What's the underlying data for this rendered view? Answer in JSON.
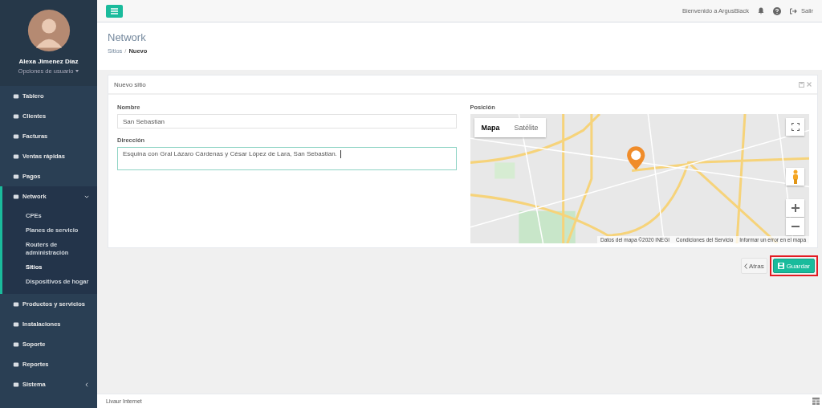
{
  "user": {
    "name": "Alexa Jimenez Díaz",
    "options": "Opciones de usuario"
  },
  "sidebar": {
    "items": [
      {
        "label": "Tablero",
        "selected": false
      },
      {
        "label": "Clientes",
        "selected": false
      },
      {
        "label": "Facturas",
        "selected": false
      },
      {
        "label": "Ventas rápidas",
        "selected": false
      },
      {
        "label": "Pagos",
        "selected": false
      },
      {
        "label": "Network",
        "selected": true,
        "expanded": true,
        "children": [
          {
            "label": "CPEs",
            "selected": false
          },
          {
            "label": "Planes de servicio",
            "selected": false
          },
          {
            "label": "Routers de administración",
            "selected": false
          },
          {
            "label": "Sitios",
            "selected": true
          },
          {
            "label": "Dispositivos de hogar",
            "selected": false
          }
        ]
      },
      {
        "label": "Productos y servicios",
        "selected": false
      },
      {
        "label": "Instalaciones",
        "selected": false
      },
      {
        "label": "Soporte",
        "selected": false
      },
      {
        "label": "Reportes",
        "selected": false
      },
      {
        "label": "Sistema",
        "selected": false,
        "expanded": false
      }
    ]
  },
  "topbar": {
    "welcome": "Bienvenido a ArgusBlack",
    "logout": "Salir"
  },
  "page": {
    "title": "Network",
    "breadcrumb": [
      {
        "label": "Sitios"
      },
      {
        "label": "Nuevo"
      }
    ],
    "separator": "/"
  },
  "panel": {
    "title": "Nuevo sitio",
    "fields": [
      {
        "label": "Nombre",
        "value": "San Sebastian",
        "kind": "input",
        "focused": false
      },
      {
        "label": "Dirección",
        "value": "Esquina con Gral Lázaro Cárdenas y César López de Lara, San Sebastian.",
        "kind": "textarea",
        "focused": true
      }
    ],
    "position": {
      "label": "Posición",
      "map_types": [
        {
          "label": "Mapa",
          "selected": true
        },
        {
          "label": "Satélite",
          "selected": false
        }
      ],
      "attribution": [
        "Datos del mapa ©2020 INEGI",
        "Condiciones del Servicio",
        "Informar un error en el mapa"
      ]
    }
  },
  "actions": {
    "back": "Atras",
    "save": "Guardar",
    "save_highlighted": true
  },
  "footer": {
    "text": "Livaur Internet"
  }
}
